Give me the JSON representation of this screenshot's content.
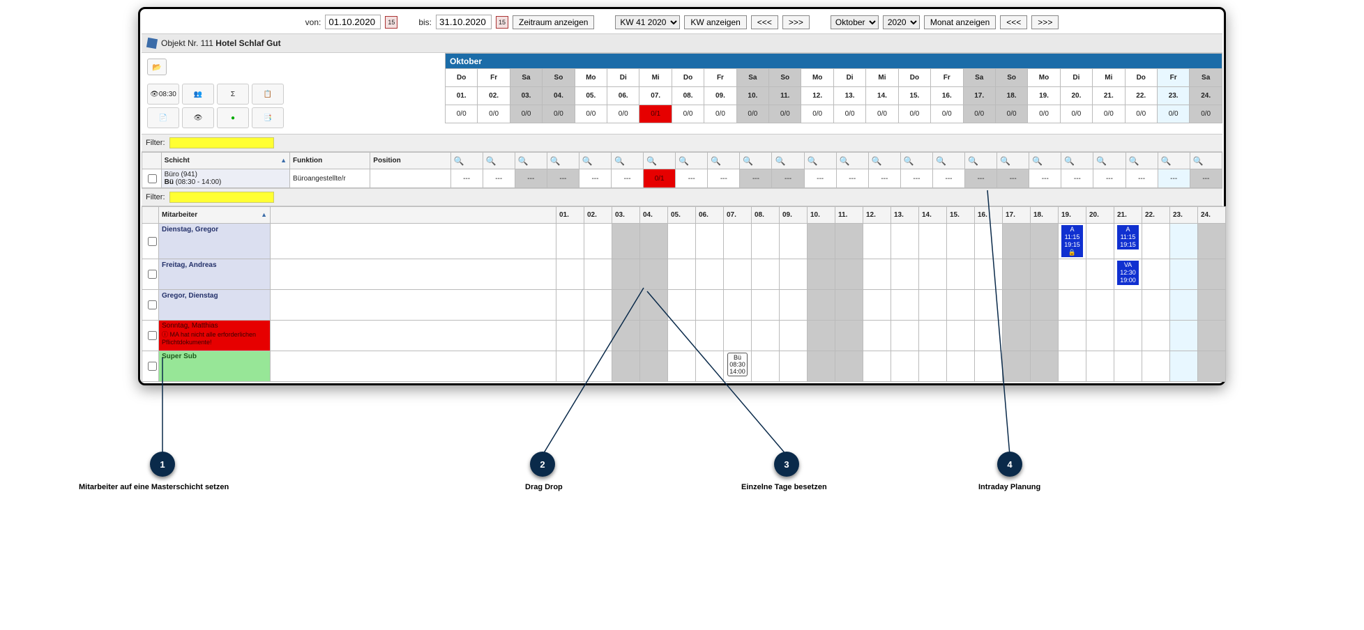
{
  "toolbar": {
    "from_label": "von:",
    "from_value": "01.10.2020",
    "to_label": "bis:",
    "to_value": "31.10.2020",
    "show_range": "Zeitraum anzeigen",
    "week_select": "KW 41 2020",
    "show_week": "KW anzeigen",
    "prev": "<<<",
    "next": ">>>",
    "month_select": "Oktober",
    "year_select": "2020",
    "show_month": "Monat anzeigen",
    "cal_day": "15"
  },
  "object": {
    "prefix": "Objekt Nr. 111",
    "name": "Hotel Schlaf Gut"
  },
  "tools": {
    "t1": "08:30",
    "t2": "👥",
    "t3": "Σ",
    "t4": "📋",
    "t5": "📄",
    "t6": "👁",
    "t7": "●",
    "t8": "📑"
  },
  "calendar": {
    "month": "Oktober",
    "weekdays": [
      "Do",
      "Fr",
      "Sa",
      "So",
      "Mo",
      "Di",
      "Mi",
      "Do",
      "Fr",
      "Sa",
      "So",
      "Mo",
      "Di",
      "Mi",
      "Do",
      "Fr",
      "Sa",
      "So",
      "Mo",
      "Di",
      "Mi",
      "Do",
      "Fr",
      "Sa"
    ],
    "dates": [
      "01.",
      "02.",
      "03.",
      "04.",
      "05.",
      "06.",
      "07.",
      "08.",
      "09.",
      "10.",
      "11.",
      "12.",
      "13.",
      "14.",
      "15.",
      "16.",
      "17.",
      "18.",
      "19.",
      "20.",
      "21.",
      "22.",
      "23.",
      "24."
    ],
    "weekend_idx": [
      2,
      3,
      9,
      10,
      16,
      17,
      23
    ],
    "today_idx": 22,
    "counts_default": "0/0",
    "counts_red_idx": 6,
    "counts_red_val": "0/1"
  },
  "filter_label": "Filter:",
  "shift": {
    "hdr_schicht": "Schicht",
    "hdr_funktion": "Funktion",
    "hdr_position": "Position",
    "name_line1": "Büro (941)",
    "name_line2_code": "Bü",
    "name_line2_time": "(08:30 - 14:00)",
    "funktion": "Büroangestellte/r",
    "dash": "---",
    "red_val": "0/1"
  },
  "emp_hdr": "Mitarbeiter",
  "employees": [
    {
      "name": "Dienstag, Gregor",
      "class": "empname",
      "shifts": {
        "19": {
          "code": "A",
          "from": "11:15",
          "to": "19:15",
          "lock": true
        },
        "21": {
          "code": "A",
          "from": "11:15",
          "to": "19:15"
        }
      }
    },
    {
      "name": "Freitag, Andreas",
      "class": "empname",
      "shifts": {
        "21": {
          "code": "VA",
          "from": "12:30",
          "to": "19:00"
        }
      }
    },
    {
      "name": "Gregor, Dienstag",
      "class": "empname",
      "shifts": {}
    },
    {
      "name": "Sonntag, Matthias",
      "class": "warn",
      "note": "ⓘ MA hat nicht alle erforderlichen Pflichtdokumente!",
      "shifts": {}
    },
    {
      "name": "Super Sub",
      "class": "green",
      "shifts": {
        "07": {
          "mini": true,
          "code": "Bü",
          "from": "08:30",
          "to": "14:00"
        }
      }
    }
  ],
  "annotations": {
    "1": "Mitarbeiter auf eine Masterschicht setzen",
    "2": "Drag  Drop",
    "3": "Einzelne Tage besetzen",
    "4": "Intraday Planung"
  }
}
